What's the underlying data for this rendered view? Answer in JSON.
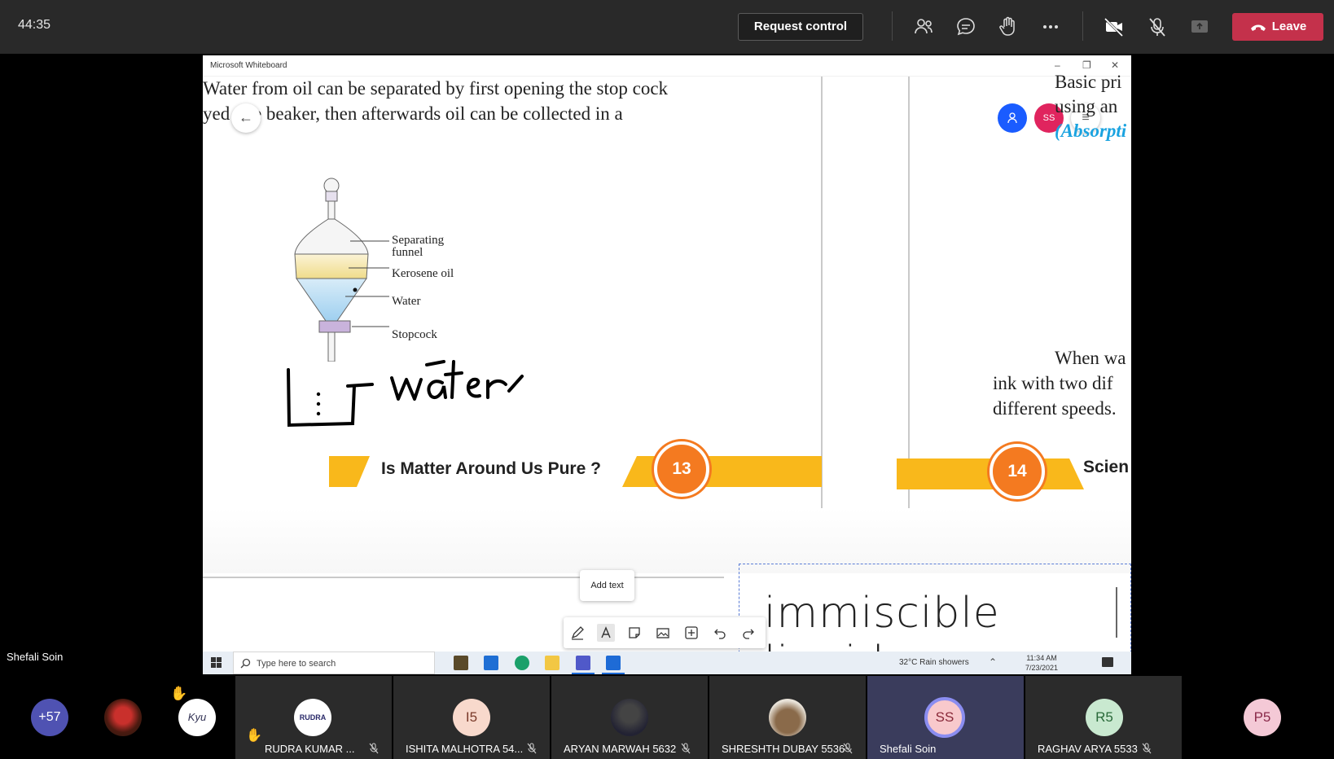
{
  "meeting": {
    "timer": "44:35",
    "request_control_label": "Request control",
    "leave_label": "Leave",
    "speaker_name": "Shefali Soin"
  },
  "whiteboard": {
    "window_title": "Microsoft Whiteboard",
    "left_page": {
      "line1": "Water from oil can be separated by first opening the stop cock",
      "line2": "yed one beaker, then afterwards oil can be collected in a",
      "diagram_labels": {
        "funnel_line1": "Separating",
        "funnel_line2": "funnel",
        "oil": "Kerosene oil",
        "water": "Water",
        "stopcock": "Stopcock"
      },
      "handwriting": "water",
      "chapter_title": "Is Matter Around Us Pure ?",
      "page_number": "13"
    },
    "right_page": {
      "line1": "Basic pri",
      "line2": "using an",
      "line3": "(Absorpti",
      "para1": "When wa",
      "para2": "ink with two dif",
      "para3": "different speeds.",
      "page_number": "14",
      "chapter_title": "Scien"
    },
    "collaborators": [
      {
        "initials": "",
        "color": "#1a5cff"
      },
      {
        "initials": "SS",
        "color": "#e0245e"
      }
    ],
    "textbox_text": "immiscible liquids",
    "tooltip": "Add text",
    "toolbar_icons": [
      "pen-icon",
      "text-icon",
      "sticky-note-icon",
      "image-icon",
      "add-icon",
      "undo-icon",
      "redo-icon"
    ]
  },
  "taskbar": {
    "search_placeholder": "Type here to search",
    "weather": "32°C  Rain showers",
    "time": "11:34 AM",
    "date": "7/23/2021"
  },
  "participants": [
    {
      "label": "+57",
      "name": ""
    },
    {
      "label": "",
      "name": ""
    },
    {
      "label": "",
      "name": ""
    },
    {
      "label": "",
      "name": "RUDRA KUMAR ..."
    },
    {
      "label": "I5",
      "name": "ISHITA MALHOTRA 54..."
    },
    {
      "label": "",
      "name": "ARYAN MARWAH 5632"
    },
    {
      "label": "",
      "name": "SHRESHTH DUBAY 5536"
    },
    {
      "label": "SS",
      "name": "Shefali Soin"
    },
    {
      "label": "R5",
      "name": "RAGHAV ARYA 5533"
    },
    {
      "label": "P5",
      "name": ""
    }
  ]
}
